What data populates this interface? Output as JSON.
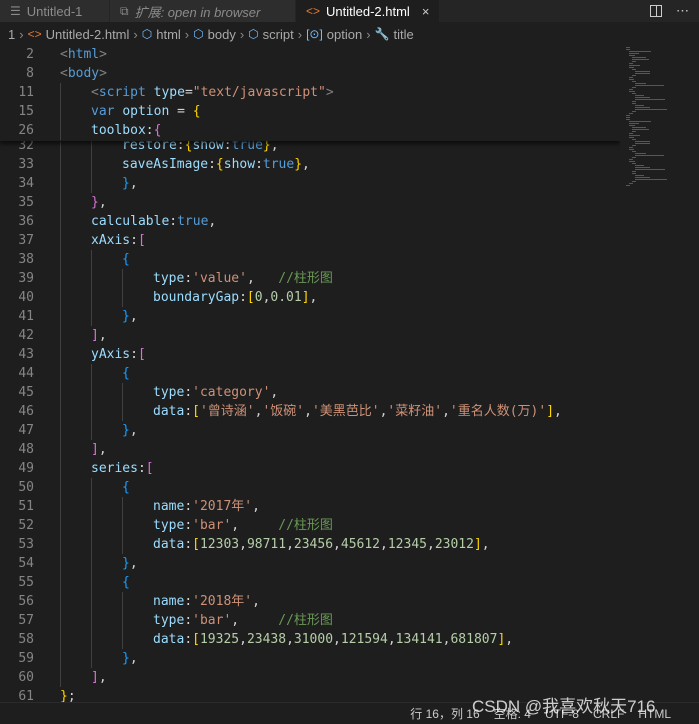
{
  "tabs": [
    {
      "label": "Untitled-1",
      "icon": "file-icon",
      "active": false,
      "italic": false
    },
    {
      "label": "扩展: open in browser",
      "icon": "extension-icon",
      "active": false,
      "italic": true
    },
    {
      "label": "Untitled-2.html",
      "icon": "html-file-icon",
      "active": true,
      "italic": false
    }
  ],
  "tab_close_glyph": "×",
  "breadcrumb": {
    "line": "1",
    "file": "Untitled-2.html",
    "items": [
      "html",
      "body",
      "script",
      "option",
      "title"
    ]
  },
  "sticky_lines": [
    {
      "n": "2",
      "tokens": [
        [
          "t-brk",
          "<"
        ],
        [
          "t-tag",
          "html"
        ],
        [
          "t-brk",
          ">"
        ]
      ],
      "indent": 0
    },
    {
      "n": "8",
      "tokens": [
        [
          "t-brk",
          "<"
        ],
        [
          "t-tag",
          "body"
        ],
        [
          "t-brk",
          ">"
        ]
      ],
      "indent": 0
    },
    {
      "n": "11",
      "tokens": [
        [
          "t-brk",
          "<"
        ],
        [
          "t-tag",
          "script"
        ],
        [
          "t-p",
          " "
        ],
        [
          "t-attr",
          "type"
        ],
        [
          "t-p",
          "="
        ],
        [
          "t-str",
          "\"text/javascript\""
        ],
        [
          "t-brk",
          ">"
        ]
      ],
      "indent": 1
    },
    {
      "n": "15",
      "tokens": [
        [
          "t-kw",
          "var"
        ],
        [
          "t-p",
          " "
        ],
        [
          "t-var",
          "option"
        ],
        [
          "t-p",
          " = "
        ],
        [
          "b1",
          "{"
        ]
      ],
      "indent": 1
    },
    {
      "n": "26",
      "tokens": [
        [
          "t-key",
          "toolbox"
        ],
        [
          "t-p",
          ":"
        ],
        [
          "b2",
          "{"
        ]
      ],
      "indent": 1
    }
  ],
  "code_lines": [
    {
      "n": "32",
      "indent": 2,
      "tokens": [
        [
          "t-key",
          "restore"
        ],
        [
          "t-p",
          ":"
        ],
        [
          "b1",
          "{"
        ],
        [
          "t-key",
          "show"
        ],
        [
          "t-p",
          ":"
        ],
        [
          "t-bool",
          "true"
        ],
        [
          "b1",
          "}"
        ],
        [
          "t-p",
          ","
        ]
      ]
    },
    {
      "n": "33",
      "indent": 2,
      "tokens": [
        [
          "t-key",
          "saveAsImage"
        ],
        [
          "t-p",
          ":"
        ],
        [
          "b1",
          "{"
        ],
        [
          "t-key",
          "show"
        ],
        [
          "t-p",
          ":"
        ],
        [
          "t-bool",
          "true"
        ],
        [
          "b1",
          "}"
        ],
        [
          "t-p",
          ","
        ]
      ]
    },
    {
      "n": "34",
      "indent": 2,
      "tokens": [
        [
          "b3",
          "}"
        ],
        [
          "t-p",
          ","
        ]
      ]
    },
    {
      "n": "35",
      "indent": 1,
      "tokens": [
        [
          "b2",
          "}"
        ],
        [
          "t-p",
          ","
        ]
      ]
    },
    {
      "n": "36",
      "indent": 1,
      "tokens": [
        [
          "t-key",
          "calculable"
        ],
        [
          "t-p",
          ":"
        ],
        [
          "t-bool",
          "true"
        ],
        [
          "t-p",
          ","
        ]
      ]
    },
    {
      "n": "37",
      "indent": 1,
      "tokens": [
        [
          "t-key",
          "xAxis"
        ],
        [
          "t-p",
          ":"
        ],
        [
          "b2",
          "["
        ]
      ]
    },
    {
      "n": "38",
      "indent": 2,
      "tokens": [
        [
          "b3",
          "{"
        ]
      ]
    },
    {
      "n": "39",
      "indent": 3,
      "tokens": [
        [
          "t-key",
          "type"
        ],
        [
          "t-p",
          ":"
        ],
        [
          "t-str",
          "'value'"
        ],
        [
          "t-p",
          ",   "
        ],
        [
          "t-com",
          "//柱形图"
        ]
      ]
    },
    {
      "n": "40",
      "indent": 3,
      "tokens": [
        [
          "t-key",
          "boundaryGap"
        ],
        [
          "t-p",
          ":"
        ],
        [
          "b1",
          "["
        ],
        [
          "t-num",
          "0"
        ],
        [
          "t-p",
          ","
        ],
        [
          "t-num",
          "0.01"
        ],
        [
          "b1",
          "]"
        ],
        [
          "t-p",
          ","
        ]
      ]
    },
    {
      "n": "41",
      "indent": 2,
      "tokens": [
        [
          "b3",
          "}"
        ],
        [
          "t-p",
          ","
        ]
      ]
    },
    {
      "n": "42",
      "indent": 1,
      "tokens": [
        [
          "b2",
          "]"
        ],
        [
          "t-p",
          ","
        ]
      ]
    },
    {
      "n": "43",
      "indent": 1,
      "tokens": [
        [
          "t-key",
          "yAxis"
        ],
        [
          "t-p",
          ":"
        ],
        [
          "b2",
          "["
        ]
      ]
    },
    {
      "n": "44",
      "indent": 2,
      "tokens": [
        [
          "b3",
          "{"
        ]
      ]
    },
    {
      "n": "45",
      "indent": 3,
      "tokens": [
        [
          "t-key",
          "type"
        ],
        [
          "t-p",
          ":"
        ],
        [
          "t-str",
          "'category'"
        ],
        [
          "t-p",
          ","
        ]
      ]
    },
    {
      "n": "46",
      "indent": 3,
      "tokens": [
        [
          "t-key",
          "data"
        ],
        [
          "t-p",
          ":"
        ],
        [
          "b1",
          "["
        ],
        [
          "t-str",
          "'曾诗涵'"
        ],
        [
          "t-p",
          ","
        ],
        [
          "t-str",
          "'饭碗'"
        ],
        [
          "t-p",
          ","
        ],
        [
          "t-str",
          "'美黑芭比'"
        ],
        [
          "t-p",
          ","
        ],
        [
          "t-str",
          "'菜籽油'"
        ],
        [
          "t-p",
          ","
        ],
        [
          "t-str",
          "'重名人数(万)'"
        ],
        [
          "b1",
          "]"
        ],
        [
          "t-p",
          ","
        ]
      ]
    },
    {
      "n": "47",
      "indent": 2,
      "tokens": [
        [
          "b3",
          "}"
        ],
        [
          "t-p",
          ","
        ]
      ]
    },
    {
      "n": "48",
      "indent": 1,
      "tokens": [
        [
          "b2",
          "]"
        ],
        [
          "t-p",
          ","
        ]
      ]
    },
    {
      "n": "49",
      "indent": 1,
      "tokens": [
        [
          "t-key",
          "series"
        ],
        [
          "t-p",
          ":"
        ],
        [
          "b2",
          "["
        ]
      ]
    },
    {
      "n": "50",
      "indent": 2,
      "tokens": [
        [
          "b3",
          "{"
        ]
      ]
    },
    {
      "n": "51",
      "indent": 3,
      "tokens": [
        [
          "t-key",
          "name"
        ],
        [
          "t-p",
          ":"
        ],
        [
          "t-str",
          "'2017年'"
        ],
        [
          "t-p",
          ","
        ]
      ]
    },
    {
      "n": "52",
      "indent": 3,
      "tokens": [
        [
          "t-key",
          "type"
        ],
        [
          "t-p",
          ":"
        ],
        [
          "t-str",
          "'bar'"
        ],
        [
          "t-p",
          ",     "
        ],
        [
          "t-com",
          "//柱形图"
        ]
      ]
    },
    {
      "n": "53",
      "indent": 3,
      "tokens": [
        [
          "t-key",
          "data"
        ],
        [
          "t-p",
          ":"
        ],
        [
          "b1",
          "["
        ],
        [
          "t-num",
          "12303"
        ],
        [
          "t-p",
          ","
        ],
        [
          "t-num",
          "98711"
        ],
        [
          "t-p",
          ","
        ],
        [
          "t-num",
          "23456"
        ],
        [
          "t-p",
          ","
        ],
        [
          "t-num",
          "45612"
        ],
        [
          "t-p",
          ","
        ],
        [
          "t-num",
          "12345"
        ],
        [
          "t-p",
          ","
        ],
        [
          "t-num",
          "23012"
        ],
        [
          "b1",
          "]"
        ],
        [
          "t-p",
          ","
        ]
      ]
    },
    {
      "n": "54",
      "indent": 2,
      "tokens": [
        [
          "b3",
          "}"
        ],
        [
          "t-p",
          ","
        ]
      ]
    },
    {
      "n": "55",
      "indent": 2,
      "tokens": [
        [
          "b3",
          "{"
        ]
      ]
    },
    {
      "n": "56",
      "indent": 3,
      "tokens": [
        [
          "t-key",
          "name"
        ],
        [
          "t-p",
          ":"
        ],
        [
          "t-str",
          "'2018年'"
        ],
        [
          "t-p",
          ","
        ]
      ]
    },
    {
      "n": "57",
      "indent": 3,
      "tokens": [
        [
          "t-key",
          "type"
        ],
        [
          "t-p",
          ":"
        ],
        [
          "t-str",
          "'bar'"
        ],
        [
          "t-p",
          ",     "
        ],
        [
          "t-com",
          "//柱形图"
        ]
      ]
    },
    {
      "n": "58",
      "indent": 3,
      "tokens": [
        [
          "t-key",
          "data"
        ],
        [
          "t-p",
          ":"
        ],
        [
          "b1",
          "["
        ],
        [
          "t-num",
          "19325"
        ],
        [
          "t-p",
          ","
        ],
        [
          "t-num",
          "23438"
        ],
        [
          "t-p",
          ","
        ],
        [
          "t-num",
          "31000"
        ],
        [
          "t-p",
          ","
        ],
        [
          "t-num",
          "121594"
        ],
        [
          "t-p",
          ","
        ],
        [
          "t-num",
          "134141"
        ],
        [
          "t-p",
          ","
        ],
        [
          "t-num",
          "681807"
        ],
        [
          "b1",
          "]"
        ],
        [
          "t-p",
          ","
        ]
      ]
    },
    {
      "n": "59",
      "indent": 2,
      "tokens": [
        [
          "b3",
          "}"
        ],
        [
          "t-p",
          ","
        ]
      ]
    },
    {
      "n": "60",
      "indent": 1,
      "tokens": [
        [
          "b2",
          "]"
        ],
        [
          "t-p",
          ","
        ]
      ]
    },
    {
      "n": "61",
      "indent": 0,
      "tokens": [
        [
          "b1",
          "}"
        ],
        [
          "t-p",
          ";"
        ]
      ]
    }
  ],
  "statusbar": {
    "position": "行 16，列 16",
    "spaces": "空格: 4",
    "encoding": "UTF-8",
    "eol": "CRLF",
    "language": "HTML"
  },
  "watermark": "CSDN @我喜欢秋天716",
  "colors": {
    "editor_bg": "#1e1e1e",
    "tab_active_icon": "#e37933",
    "keyword": "#569cd6",
    "string": "#ce9178",
    "number": "#b5cea8",
    "comment": "#6a9955"
  }
}
